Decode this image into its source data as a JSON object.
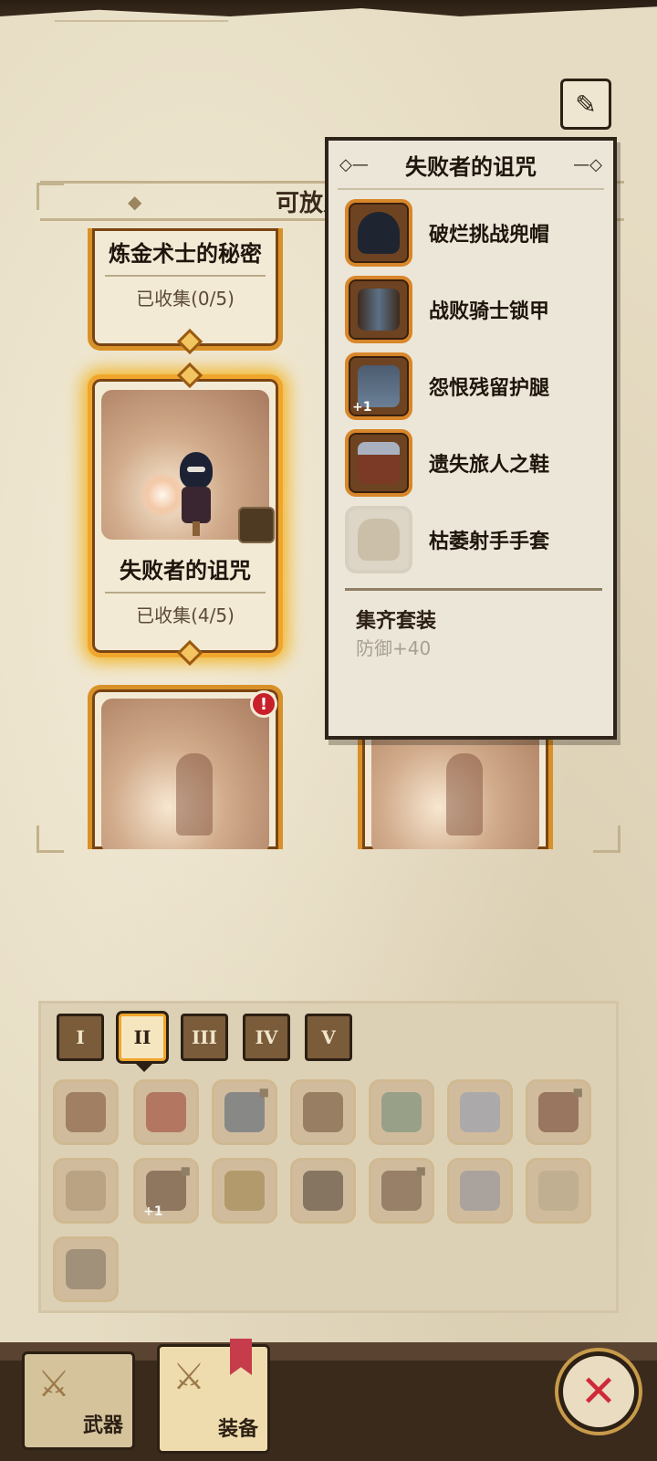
{
  "colors": {
    "accent_orange": "#d99127",
    "selected_glow": "#f1b72f",
    "alert_red": "#c8202a",
    "close_red": "#cf2a3a"
  },
  "header": {
    "section_title": "可放入套",
    "edit_icon": "pen-icon"
  },
  "cards": [
    {
      "name": "炼金术士的秘密",
      "progress": "已收集(0/5)"
    },
    {
      "name": "失败者的诅咒",
      "progress": "已收集(4/5)",
      "selected": true
    }
  ],
  "alert_badge": "!",
  "popup": {
    "title": "失败者的诅咒",
    "pieces": [
      {
        "name": "破烂挑战兜帽",
        "icon": "hood-icon",
        "collected": true
      },
      {
        "name": "战败骑士锁甲",
        "icon": "armor-icon",
        "collected": true
      },
      {
        "name": "怨恨残留护腿",
        "icon": "leggings-icon",
        "collected": true,
        "badge": "+1"
      },
      {
        "name": "遗失旅人之鞋",
        "icon": "boots-icon",
        "collected": true
      },
      {
        "name": "枯萎射手手套",
        "icon": "glove-icon",
        "collected": false
      }
    ],
    "set_label": "集齐套装",
    "set_bonus": "防御+40"
  },
  "tiers": [
    "I",
    "II",
    "III",
    "IV",
    "V"
  ],
  "active_tier": "II",
  "grid_badge": "+1",
  "nav": {
    "weapons_label": "武器",
    "equipment_label": "装备",
    "close_label": "✕"
  }
}
